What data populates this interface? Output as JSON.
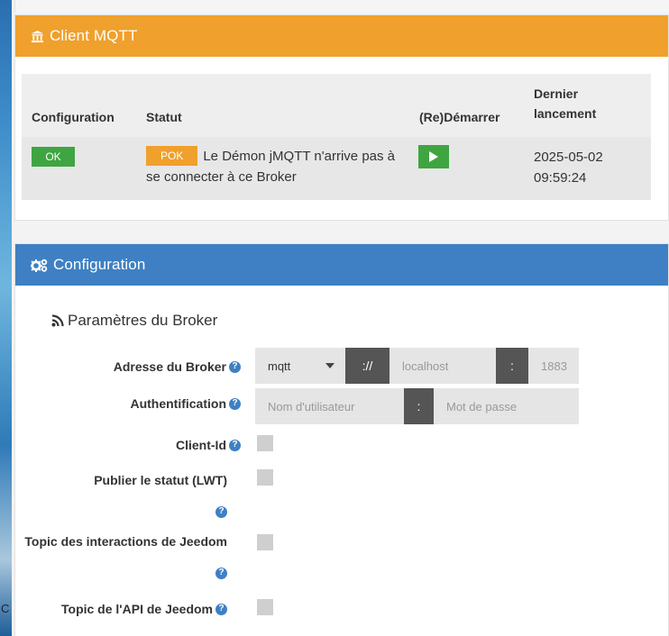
{
  "mqtt_panel": {
    "title": "Client MQTT",
    "columns": {
      "configuration": "Configuration",
      "status": "Statut",
      "restart": "(Re)Démarrer",
      "last_run": "Dernier lancement"
    },
    "row": {
      "config_badge": "OK",
      "status_badge": "POK",
      "status_message": "Le Démon jMQTT n'arrive pas à se connecter à ce Broker",
      "last_run": "2025-05-02 09:59:24"
    },
    "colors": {
      "heading": "#f0a02c",
      "ok": "#3fa541",
      "pok": "#f0a02c"
    }
  },
  "config_panel": {
    "title": "Configuration",
    "section_title": "Paramètres du Broker",
    "fields": {
      "broker_address": {
        "label": "Adresse du Broker",
        "protocol": "mqtt",
        "separator": "://",
        "host_placeholder": "localhost",
        "port_separator": ":",
        "port_placeholder": "1883"
      },
      "authentication": {
        "label": "Authentification",
        "user_placeholder": "Nom d'utilisateur",
        "separator": ":",
        "password_placeholder": "Mot de passe"
      },
      "client_id": {
        "label": "Client-Id"
      },
      "publish_status": {
        "label": "Publier le statut (LWT)"
      },
      "interactions_topic": {
        "label": "Topic des interactions de Jeedom"
      },
      "api_topic": {
        "label": "Topic de l'API de Jeedom"
      }
    },
    "colors": {
      "heading": "#3e80c3",
      "help": "#3e80c3"
    }
  },
  "background": {
    "edge_letter": "C"
  }
}
